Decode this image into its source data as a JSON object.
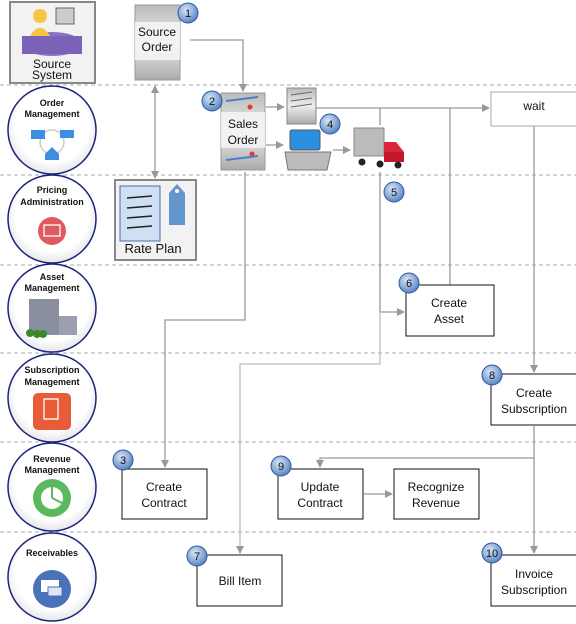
{
  "lanes": [
    {
      "label_lines": [
        "Source",
        "System"
      ],
      "icon": "person-computer-icon"
    },
    {
      "label_lines": [
        "Order",
        "Management"
      ],
      "icon": "order-cycle-icon"
    },
    {
      "label_lines": [
        "Pricing",
        "Administration"
      ],
      "icon": "pricing-icon",
      "color": "#e05a5f"
    },
    {
      "label_lines": [
        "Asset",
        "Management"
      ],
      "icon": "building-icon"
    },
    {
      "label_lines": [
        "Subscription",
        "Management"
      ],
      "icon": "scroll-icon",
      "color": "#e85c3a"
    },
    {
      "label_lines": [
        "Revenue",
        "Management"
      ],
      "icon": "pie-chart-icon",
      "color": "#5cb85c"
    },
    {
      "label_lines": [
        "Receivables"
      ],
      "icon": "invoice-envelope-icon",
      "color": "#4a72b8"
    }
  ],
  "documents": {
    "source_order": [
      "Source",
      "Order"
    ],
    "sales_order": [
      "Sales",
      "Order"
    ],
    "rate_plan": "Rate Plan"
  },
  "steps": {
    "wait": "wait",
    "create_asset": [
      "Create",
      "Asset"
    ],
    "create_subscription": [
      "Create",
      "Subscription"
    ],
    "create_contract": [
      "Create",
      "Contract"
    ],
    "update_contract": [
      "Update",
      "Contract"
    ],
    "recognize_revenue": [
      "Recognize",
      "Revenue"
    ],
    "bill_item": "Bill Item",
    "invoice_subscription": [
      "Invoice",
      "Subscription"
    ]
  },
  "badges": [
    "1",
    "2",
    "3",
    "4",
    "5",
    "6",
    "7",
    "8",
    "9",
    "10"
  ],
  "colors": {
    "badge": "#6f9bd6",
    "lane_circle_border": "#1a237e",
    "flow_line": "#999999"
  }
}
